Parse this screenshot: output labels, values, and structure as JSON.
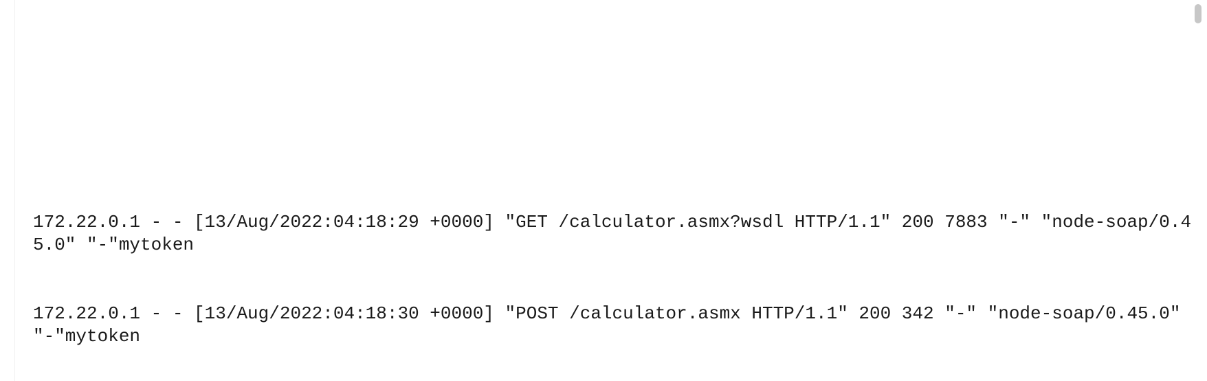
{
  "log": {
    "lines": [
      "172.22.0.1 - - [13/Aug/2022:04:18:29 +0000] \"GET /calculator.asmx?wsdl HTTP/1.1\" 200 7883 \"-\" \"node-soap/0.45.0\" \"-\"mytoken",
      "172.22.0.1 - - [13/Aug/2022:04:18:30 +0000] \"POST /calculator.asmx HTTP/1.1\" 200 342 \"-\" \"node-soap/0.45.0\" \"-\"mytoken"
    ]
  }
}
